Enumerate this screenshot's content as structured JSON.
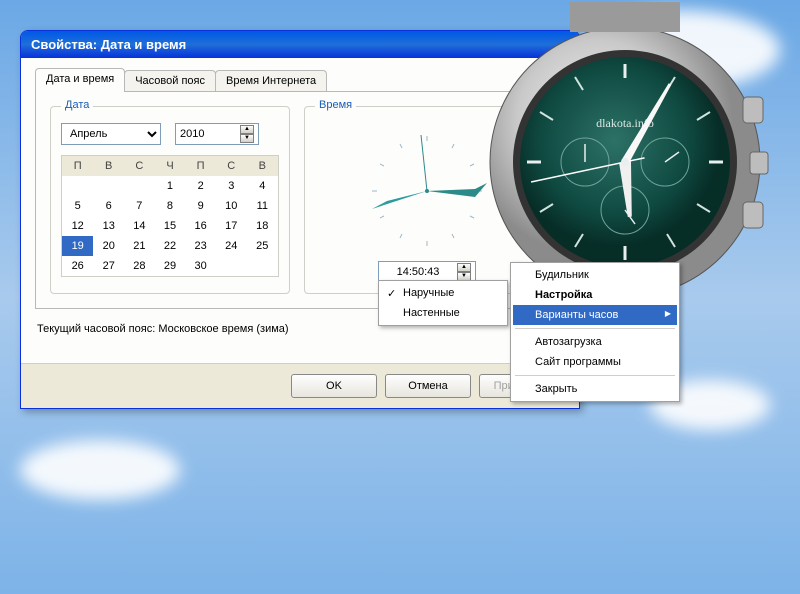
{
  "window": {
    "title": "Свойства: Дата и время"
  },
  "tabs": [
    {
      "label": "Дата и время",
      "active": true
    },
    {
      "label": "Часовой пояс",
      "active": false
    },
    {
      "label": "Время Интернета",
      "active": false
    }
  ],
  "date_group": {
    "legend": "Дата",
    "month": "Апрель",
    "year": "2010",
    "weekdays": [
      "П",
      "В",
      "С",
      "Ч",
      "П",
      "С",
      "В"
    ],
    "weeks": [
      [
        "",
        "",
        "",
        "1",
        "2",
        "3",
        "4"
      ],
      [
        "5",
        "6",
        "7",
        "8",
        "9",
        "10",
        "11"
      ],
      [
        "12",
        "13",
        "14",
        "15",
        "16",
        "17",
        "18"
      ],
      [
        "19",
        "20",
        "21",
        "22",
        "23",
        "24",
        "25"
      ],
      [
        "26",
        "27",
        "28",
        "29",
        "30",
        "",
        ""
      ]
    ],
    "selected": "19"
  },
  "time_group": {
    "legend": "Время",
    "value": "14:50:43"
  },
  "timezone_label": "Текущий часовой пояс: Московское время (зима)",
  "buttons": {
    "ok": "OK",
    "cancel": "Отмена",
    "apply": "Применить"
  },
  "submenu": {
    "items": [
      {
        "label": "Наручные",
        "checked": true
      },
      {
        "label": "Настенные",
        "checked": false
      }
    ]
  },
  "context_menu": {
    "items": [
      {
        "label": "Будильник"
      },
      {
        "label": "Настройка",
        "bold": true
      },
      {
        "label": "Варианты часов",
        "selected": true,
        "arrow": true
      },
      {
        "sep": true
      },
      {
        "label": "Автозагрузка"
      },
      {
        "label": "Сайт программы"
      },
      {
        "sep": true
      },
      {
        "label": "Закрыть"
      }
    ]
  },
  "watch": {
    "brand": "dlakota.info"
  }
}
